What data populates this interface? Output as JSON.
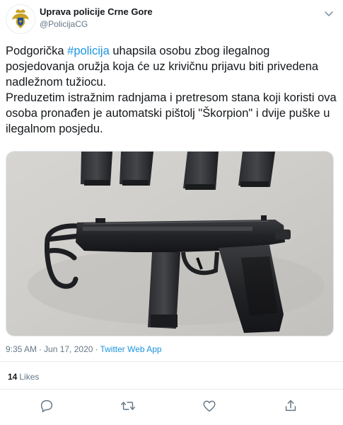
{
  "author": {
    "display_name": "Uprava policije Crne Gore",
    "handle": "@PolicijaCG",
    "avatar_icon": "coat-of-arms-icon"
  },
  "tweet": {
    "text_before_hashtag": "Podgorička ",
    "hashtag": "#policija",
    "text_after_hashtag": " uhapsila osobu zbog ilegalnog posjedovanja oružja koja će uz krivičnu prijavu biti privedena nadležnom tužiocu.",
    "paragraph2": "Preduzetim istražnim radnjama i pretresom stana koji koristi ova osoba pronađen je automatski pištolj \"Škorpion\" i dvije puške u ilegalnom posjedu."
  },
  "meta": {
    "time": "9:35 AM",
    "separator": "·",
    "date": "Jun 17, 2020",
    "source": "Twitter Web App"
  },
  "engagement": {
    "likes_count": "14",
    "likes_label": "Likes"
  },
  "actions": [
    "reply-icon",
    "retweet-icon",
    "like-icon",
    "share-icon"
  ],
  "colors": {
    "link": "#1b95e0",
    "text": "#14171a",
    "muted": "#657786",
    "border": "#e6ecf0"
  }
}
